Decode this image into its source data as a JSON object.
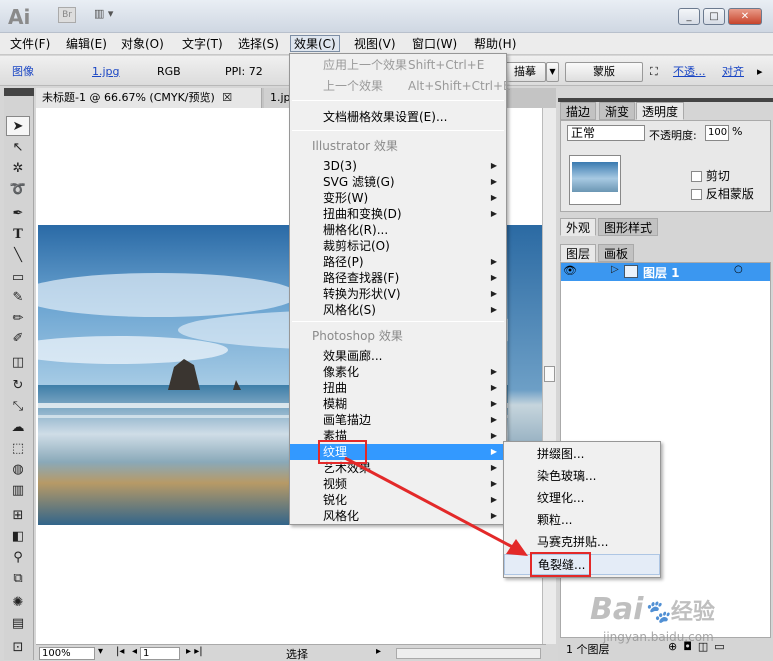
{
  "titlebar": {
    "app_logo": "Ai",
    "bridge_label": "Br",
    "min": "_",
    "max": "□",
    "close": "✕"
  },
  "menubar": [
    "文件(F)",
    "编辑(E)",
    "对象(O)",
    "文字(T)",
    "选择(S)",
    "效果(C)",
    "视图(V)",
    "窗口(W)",
    "帮助(H)"
  ],
  "controlbar": {
    "image_label": "图像",
    "file": "1.jpg",
    "color_mode": "RGB",
    "ppi": "PPI: 72",
    "trace_btn": "描摹",
    "mask_btn": "蒙版",
    "opacity_link": "不透...",
    "align_link": "对齐"
  },
  "tabs": {
    "doc1": "未标题-1 @ 66.67% (CMYK/预览)",
    "doc1_close": "☒",
    "doc2": "1.jp"
  },
  "effect_menu": {
    "apply_last": "应用上一个效果",
    "apply_last_sc": "Shift+Ctrl+E",
    "last_effect": "上一个效果",
    "last_effect_sc": "Alt+Shift+Ctrl+E",
    "raster_settings": "文档栅格效果设置(E)...",
    "illustrator_header": "Illustrator 效果",
    "illustrator_items": [
      "3D(3)",
      "SVG 滤镜(G)",
      "变形(W)",
      "扭曲和变换(D)",
      "栅格化(R)...",
      "裁剪标记(O)",
      "路径(P)",
      "路径查找器(F)",
      "转换为形状(V)",
      "风格化(S)"
    ],
    "photoshop_header": "Photoshop 效果",
    "photoshop_items": [
      "效果画廊...",
      "像素化",
      "扭曲",
      "模糊",
      "画笔描边",
      "素描",
      "纹理",
      "艺术效果",
      "视频",
      "锐化",
      "风格化"
    ]
  },
  "texture_submenu": [
    "拼缀图...",
    "染色玻璃...",
    "纹理化...",
    "颗粒...",
    "马赛克拼贴...",
    "龟裂缝..."
  ],
  "right_panel": {
    "tabs1": [
      "描边",
      "渐变",
      "透明度"
    ],
    "blend_mode": "正常",
    "opacity_label": "不透明度:",
    "opacity_value": "100",
    "opacity_unit": "%",
    "clip_label": "剪切",
    "invert_mask_label": "反相蒙版",
    "tabs2": [
      "外观",
      "图形样式"
    ],
    "tabs3": [
      "图层",
      "画板"
    ],
    "layer_name": "图层 1",
    "layer_count": "1 个图层"
  },
  "statusbar": {
    "zoom": "100%",
    "page": "1",
    "tool": "选择"
  },
  "watermark": {
    "brand": "Bai",
    "brand2": "经验",
    "url": "jingyan.baidu.com"
  }
}
